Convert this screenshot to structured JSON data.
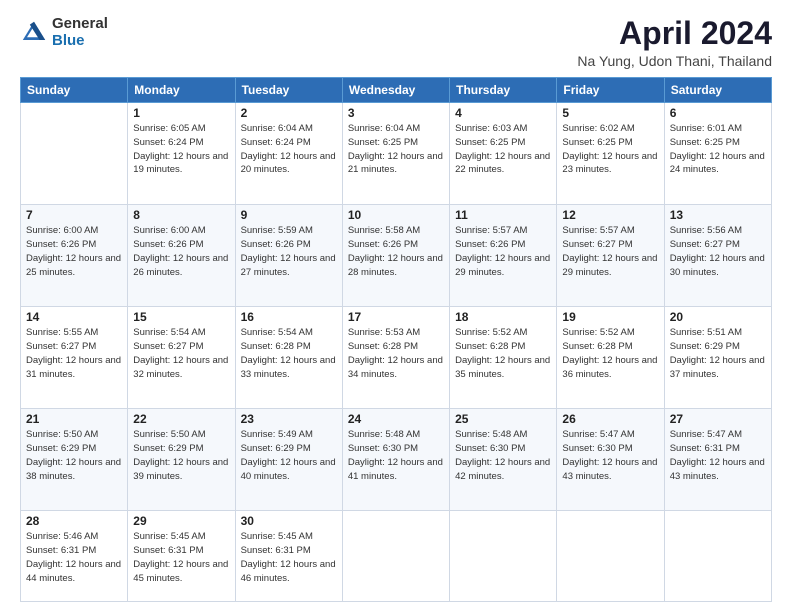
{
  "logo": {
    "general": "General",
    "blue": "Blue"
  },
  "title": "April 2024",
  "subtitle": "Na Yung, Udon Thani, Thailand",
  "headers": [
    "Sunday",
    "Monday",
    "Tuesday",
    "Wednesday",
    "Thursday",
    "Friday",
    "Saturday"
  ],
  "weeks": [
    [
      {
        "day": "",
        "info": ""
      },
      {
        "day": "1",
        "info": "Sunrise: 6:05 AM\nSunset: 6:24 PM\nDaylight: 12 hours\nand 19 minutes."
      },
      {
        "day": "2",
        "info": "Sunrise: 6:04 AM\nSunset: 6:24 PM\nDaylight: 12 hours\nand 20 minutes."
      },
      {
        "day": "3",
        "info": "Sunrise: 6:04 AM\nSunset: 6:25 PM\nDaylight: 12 hours\nand 21 minutes."
      },
      {
        "day": "4",
        "info": "Sunrise: 6:03 AM\nSunset: 6:25 PM\nDaylight: 12 hours\nand 22 minutes."
      },
      {
        "day": "5",
        "info": "Sunrise: 6:02 AM\nSunset: 6:25 PM\nDaylight: 12 hours\nand 23 minutes."
      },
      {
        "day": "6",
        "info": "Sunrise: 6:01 AM\nSunset: 6:25 PM\nDaylight: 12 hours\nand 24 minutes."
      }
    ],
    [
      {
        "day": "7",
        "info": "Sunrise: 6:00 AM\nSunset: 6:26 PM\nDaylight: 12 hours\nand 25 minutes."
      },
      {
        "day": "8",
        "info": "Sunrise: 6:00 AM\nSunset: 6:26 PM\nDaylight: 12 hours\nand 26 minutes."
      },
      {
        "day": "9",
        "info": "Sunrise: 5:59 AM\nSunset: 6:26 PM\nDaylight: 12 hours\nand 27 minutes."
      },
      {
        "day": "10",
        "info": "Sunrise: 5:58 AM\nSunset: 6:26 PM\nDaylight: 12 hours\nand 28 minutes."
      },
      {
        "day": "11",
        "info": "Sunrise: 5:57 AM\nSunset: 6:26 PM\nDaylight: 12 hours\nand 29 minutes."
      },
      {
        "day": "12",
        "info": "Sunrise: 5:57 AM\nSunset: 6:27 PM\nDaylight: 12 hours\nand 29 minutes."
      },
      {
        "day": "13",
        "info": "Sunrise: 5:56 AM\nSunset: 6:27 PM\nDaylight: 12 hours\nand 30 minutes."
      }
    ],
    [
      {
        "day": "14",
        "info": "Sunrise: 5:55 AM\nSunset: 6:27 PM\nDaylight: 12 hours\nand 31 minutes."
      },
      {
        "day": "15",
        "info": "Sunrise: 5:54 AM\nSunset: 6:27 PM\nDaylight: 12 hours\nand 32 minutes."
      },
      {
        "day": "16",
        "info": "Sunrise: 5:54 AM\nSunset: 6:28 PM\nDaylight: 12 hours\nand 33 minutes."
      },
      {
        "day": "17",
        "info": "Sunrise: 5:53 AM\nSunset: 6:28 PM\nDaylight: 12 hours\nand 34 minutes."
      },
      {
        "day": "18",
        "info": "Sunrise: 5:52 AM\nSunset: 6:28 PM\nDaylight: 12 hours\nand 35 minutes."
      },
      {
        "day": "19",
        "info": "Sunrise: 5:52 AM\nSunset: 6:28 PM\nDaylight: 12 hours\nand 36 minutes."
      },
      {
        "day": "20",
        "info": "Sunrise: 5:51 AM\nSunset: 6:29 PM\nDaylight: 12 hours\nand 37 minutes."
      }
    ],
    [
      {
        "day": "21",
        "info": "Sunrise: 5:50 AM\nSunset: 6:29 PM\nDaylight: 12 hours\nand 38 minutes."
      },
      {
        "day": "22",
        "info": "Sunrise: 5:50 AM\nSunset: 6:29 PM\nDaylight: 12 hours\nand 39 minutes."
      },
      {
        "day": "23",
        "info": "Sunrise: 5:49 AM\nSunset: 6:29 PM\nDaylight: 12 hours\nand 40 minutes."
      },
      {
        "day": "24",
        "info": "Sunrise: 5:48 AM\nSunset: 6:30 PM\nDaylight: 12 hours\nand 41 minutes."
      },
      {
        "day": "25",
        "info": "Sunrise: 5:48 AM\nSunset: 6:30 PM\nDaylight: 12 hours\nand 42 minutes."
      },
      {
        "day": "26",
        "info": "Sunrise: 5:47 AM\nSunset: 6:30 PM\nDaylight: 12 hours\nand 43 minutes."
      },
      {
        "day": "27",
        "info": "Sunrise: 5:47 AM\nSunset: 6:31 PM\nDaylight: 12 hours\nand 43 minutes."
      }
    ],
    [
      {
        "day": "28",
        "info": "Sunrise: 5:46 AM\nSunset: 6:31 PM\nDaylight: 12 hours\nand 44 minutes."
      },
      {
        "day": "29",
        "info": "Sunrise: 5:45 AM\nSunset: 6:31 PM\nDaylight: 12 hours\nand 45 minutes."
      },
      {
        "day": "30",
        "info": "Sunrise: 5:45 AM\nSunset: 6:31 PM\nDaylight: 12 hours\nand 46 minutes."
      },
      {
        "day": "",
        "info": ""
      },
      {
        "day": "",
        "info": ""
      },
      {
        "day": "",
        "info": ""
      },
      {
        "day": "",
        "info": ""
      }
    ]
  ]
}
